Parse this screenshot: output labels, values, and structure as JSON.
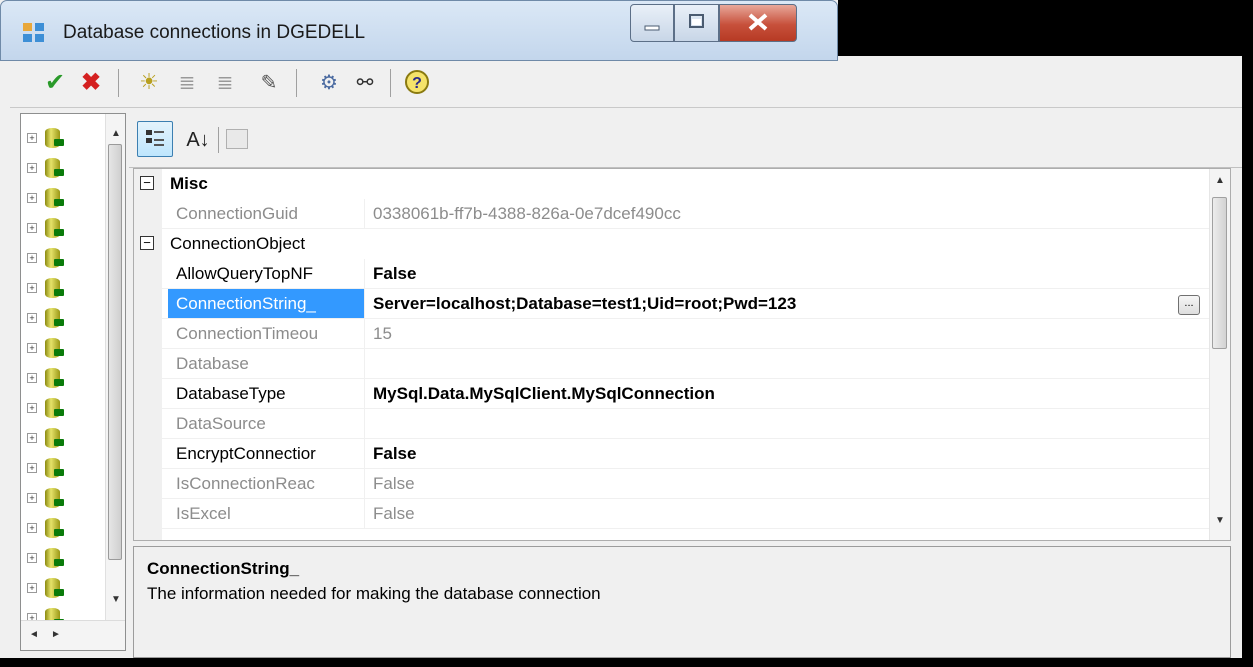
{
  "window": {
    "title": "Database connections in DGEDELL"
  },
  "toolbar": {
    "buttons": [
      "accept",
      "cancel",
      "new-connection",
      "edit-list",
      "remove-list",
      "wizard",
      "test-connection",
      "compare",
      "help"
    ]
  },
  "tree": {
    "node_count": 17
  },
  "property_grid": {
    "rows": [
      {
        "label": "Misc",
        "value": "",
        "type": "category"
      },
      {
        "label": "ConnectionGuid",
        "value": "0338061b-ff7b-4388-826a-0e7dcef490cc",
        "type": "readonly"
      },
      {
        "label": "ConnectionObject",
        "value": "",
        "type": "subcategory"
      },
      {
        "label": "AllowQueryTopNF",
        "value": "False",
        "type": "modified"
      },
      {
        "label": "ConnectionString_",
        "value": "Server=localhost;Database=test1;Uid=root;Pwd=123",
        "type": "selected"
      },
      {
        "label": "ConnectionTimeou",
        "value": "15",
        "type": "readonly"
      },
      {
        "label": "Database",
        "value": "",
        "type": "readonly"
      },
      {
        "label": "DatabaseType",
        "value": "MySql.Data.MySqlClient.MySqlConnection",
        "type": "modified"
      },
      {
        "label": "DataSource",
        "value": "",
        "type": "readonly"
      },
      {
        "label": "EncryptConnectior",
        "value": "False",
        "type": "modified"
      },
      {
        "label": "IsConnectionReac",
        "value": "False",
        "type": "readonly"
      },
      {
        "label": "IsExcel",
        "value": "False",
        "type": "readonly"
      }
    ],
    "ellipsis_label": "..."
  },
  "help": {
    "title": "ConnectionString_",
    "description": "The information needed for making the database connection"
  },
  "colors": {
    "selection": "#3399ff",
    "readonly_text": "#8c8c8c"
  }
}
